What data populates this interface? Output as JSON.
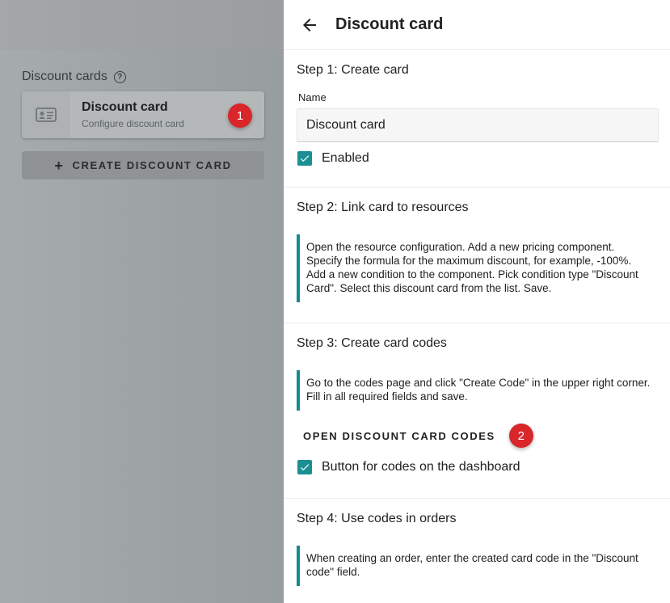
{
  "left": {
    "list_title": "Discount cards",
    "help_icon_glyph": "?",
    "card": {
      "title": "Discount card",
      "subtitle": "Configure discount card",
      "icon": "id-card-icon"
    },
    "badge1": "1",
    "create_button": {
      "icon_glyph": "+",
      "label": "CREATE DISCOUNT CARD"
    }
  },
  "panel": {
    "title": "Discount card",
    "step1": {
      "title": "Step 1: Create card",
      "name_label": "Name",
      "name_value": "Discount card",
      "enabled_label": "Enabled",
      "enabled_checked": true
    },
    "step2": {
      "title": "Step 2: Link card to resources",
      "info": "Open the resource configuration. Add a new pricing component. Specify the formula for the maximum discount, for example, -100%. Add a new condition to the component. Pick condition type \"Discount Card\". Select this discount card from the list. Save."
    },
    "step3": {
      "title": "Step 3: Create card codes",
      "info": "Go to the codes page and click \"Create Code\" in the upper right corner. Fill in all required fields and save.",
      "open_button": "OPEN DISCOUNT CARD CODES",
      "badge2": "2",
      "dashboard_label": "Button for codes on the dashboard",
      "dashboard_checked": true
    },
    "step4": {
      "title": "Step 4: Use codes in orders",
      "info": "When creating an order, enter the created card code in the \"Discount code\" field."
    }
  },
  "colors": {
    "accent": "#1b8f93",
    "info_border": "#128c91",
    "badge": "#d8262b"
  }
}
